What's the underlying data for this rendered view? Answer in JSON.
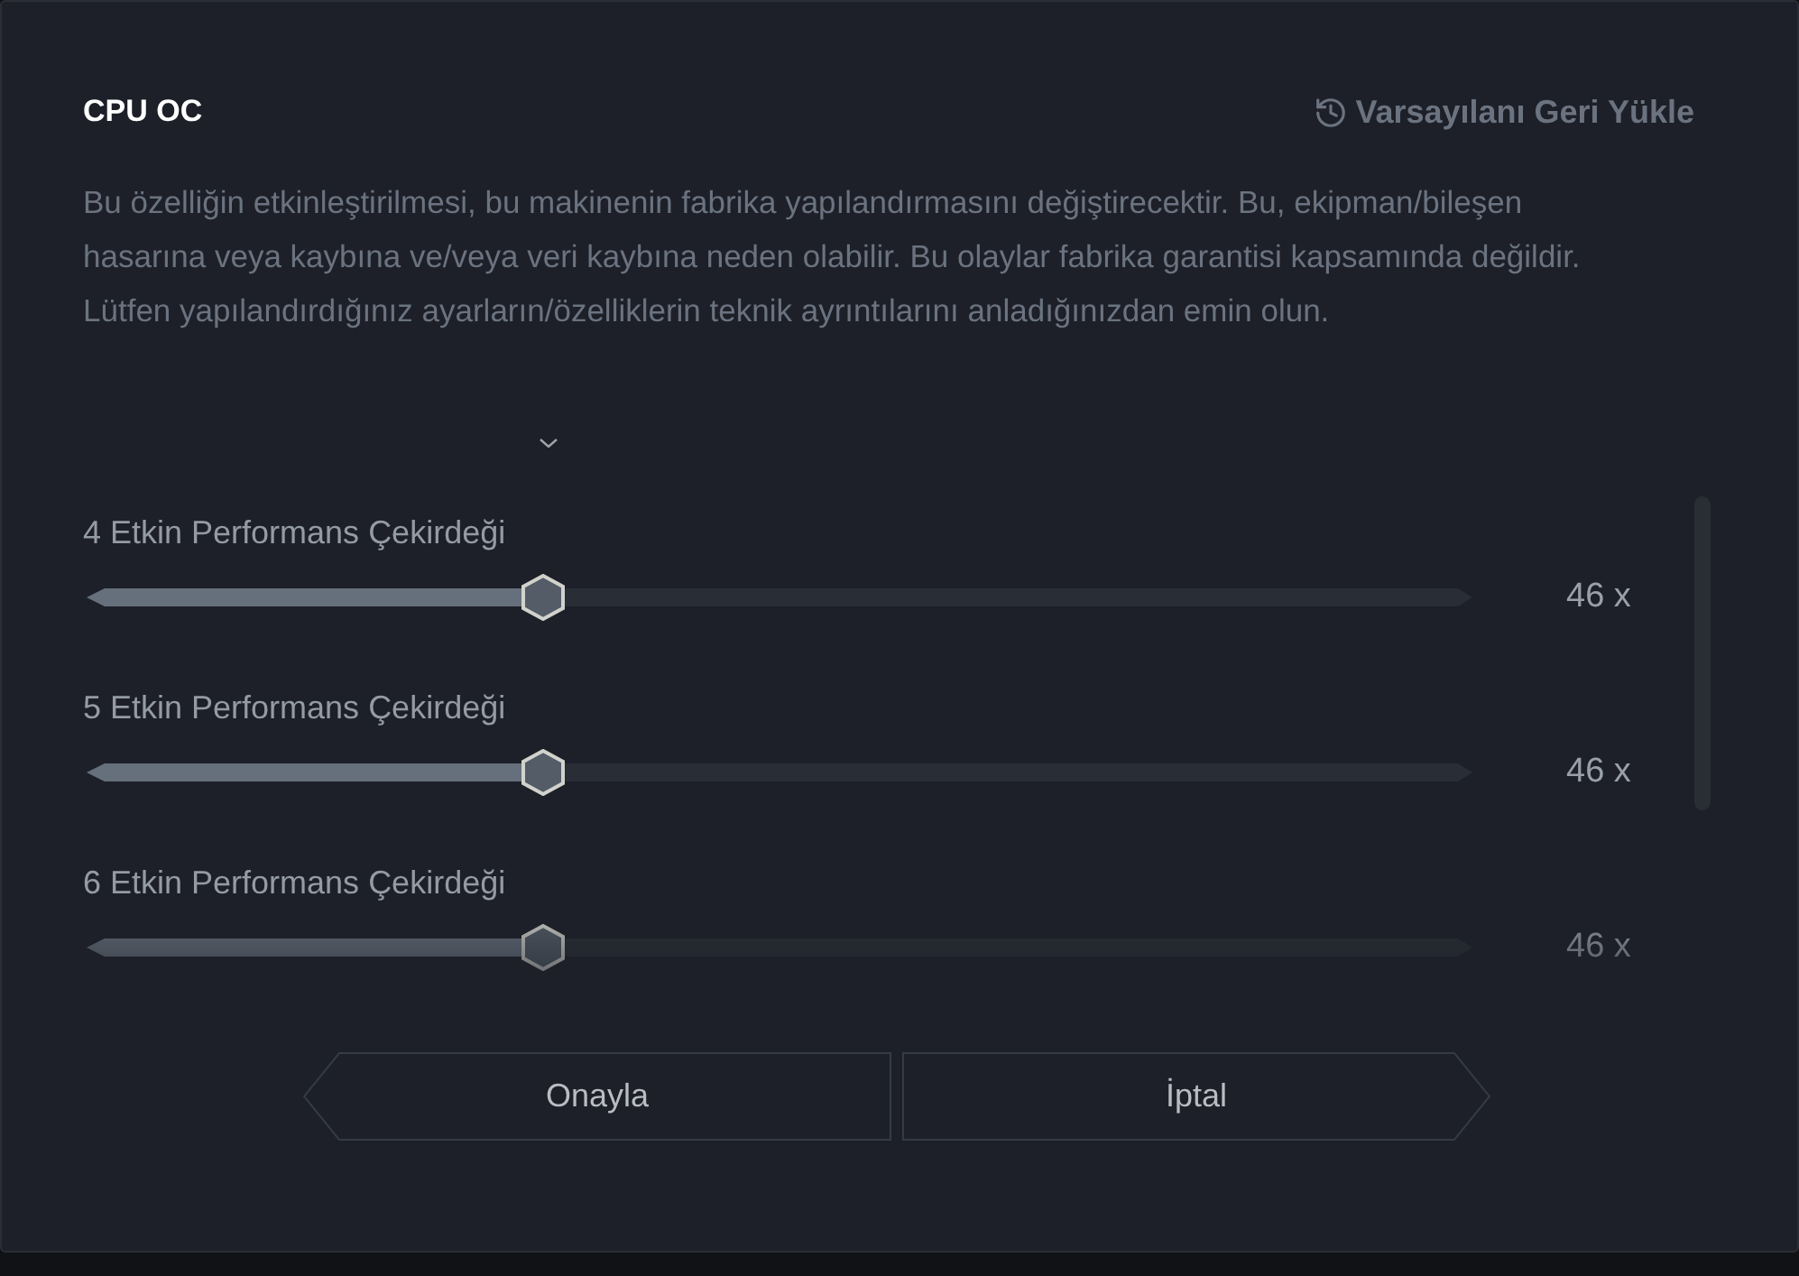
{
  "dialog": {
    "title": "CPU OC",
    "restore_button": {
      "label": "Varsayılanı Geri Yükle"
    },
    "warning": "Bu özelliğin etkinleştirilmesi, bu makinenin fabrika yapılandırmasını değiştirecektir. Bu, ekipman/bileşen hasarına veya kaybına ve/veya veri kaybına neden olabilir. Bu olaylar fabrika garantisi kapsamında değildir. Lütfen yapılandırdığınız ayarların/özelliklerin teknik ayrıntılarını anladığınızdan emin olun.",
    "sliders": [
      {
        "label": "4 Etkin Performans Çekirdeği",
        "level": 0.33,
        "reading": "46 x"
      },
      {
        "label": "5 Etkin Performans Çekirdeği",
        "level": 0.33,
        "reading": "46 x"
      },
      {
        "label": "6 Etkin Performans Çekirdeği",
        "level": 0.33,
        "reading": "46 x"
      }
    ],
    "buttons": [
      {
        "label": "Onayla",
        "kind": "confirm"
      },
      {
        "label": "İptal",
        "kind": "cancel"
      }
    ]
  }
}
